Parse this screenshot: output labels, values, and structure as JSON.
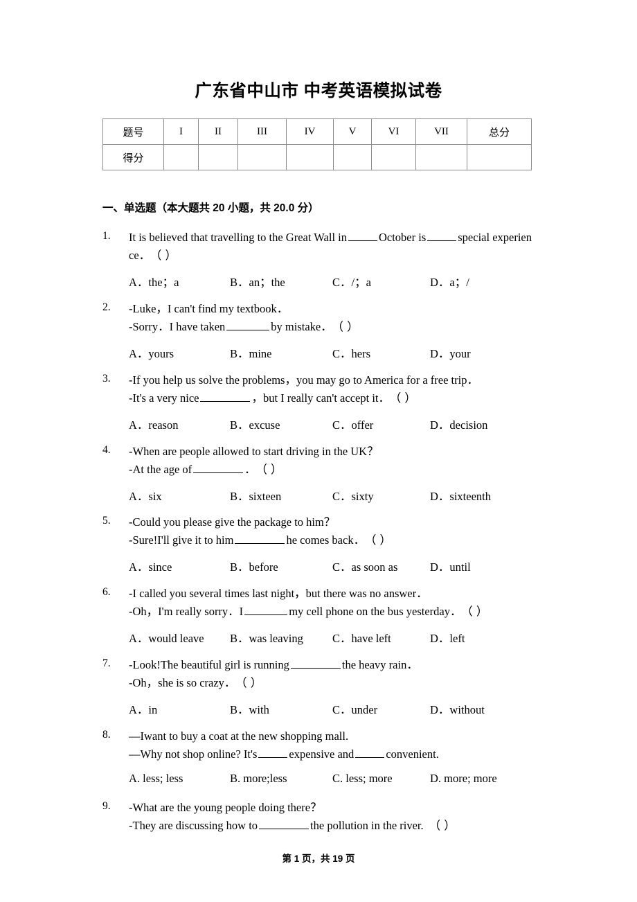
{
  "document": {
    "title": "广东省中山市 中考英语模拟试卷",
    "footer": "第 1 页，共 19 页"
  },
  "score_table": {
    "row_label_header": "题号",
    "row_label_score": "得分",
    "columns": [
      "I",
      "II",
      "III",
      "IV",
      "V",
      "VI",
      "VII"
    ],
    "total_label": "总分",
    "scores": [
      "",
      "",
      "",
      "",
      "",
      "",
      "",
      ""
    ]
  },
  "sections": [
    {
      "heading": "一、单选题（本大题共 20 小题，共 20.0 分）"
    }
  ],
  "questions": [
    {
      "number": "1.",
      "lines": [
        "It is believed that travelling to the Great Wall in ____ October is ____ special experience．（      ）"
      ],
      "line1_pre": "It is believed that travelling to the Great Wall in",
      "line1_mid": "October is",
      "line1_post": "special experien",
      "line2_pre": "ce．",
      "line2_paren": "（      ）",
      "options": [
        "A．the；a",
        "B．an；the",
        "C．/；a",
        "D．a；/"
      ]
    },
    {
      "number": "2.",
      "line1": "-Luke，I can't find my textbook．",
      "line2_pre": "-Sorry．I have taken",
      "line2_post": "by mistake．",
      "line2_paren": "（      ）",
      "options": [
        "A．yours",
        "B．mine",
        "C．hers",
        "D．your"
      ]
    },
    {
      "number": "3.",
      "line1": "-If you help us solve the problems，you may go to America for a free trip．",
      "line2_pre": "-It's a very nice",
      "line2_post": "，but I really can't accept it．",
      "line2_paren": "（      ）",
      "options": [
        "A．reason",
        "B．excuse",
        "C．offer",
        "D．decision"
      ]
    },
    {
      "number": "4.",
      "line1": "-When are people allowed to start driving in the UK？",
      "line2_pre": "-At the age of",
      "line2_post": "．",
      "line2_paren": "（      ）",
      "options": [
        "A．six",
        "B．sixteen",
        "C．sixty",
        "D．sixteenth"
      ]
    },
    {
      "number": "5.",
      "line1": "-Could you please give the package to him？",
      "line2_pre": "-Sure!I'll give it to him",
      "line2_post": "he comes back．",
      "line2_paren": "（      ）",
      "options": [
        "A．since",
        "B．before",
        "C．as soon as",
        "D．until"
      ]
    },
    {
      "number": "6.",
      "line1": "-I called you several times last night，but there was no answer．",
      "line2_pre": "-Oh，I'm really sorry．I",
      "line2_post": "my cell phone on the bus yesterday．",
      "line2_paren": "（      ）",
      "options": [
        "A．would leave",
        "B．was leaving",
        "C．have left",
        "D．left"
      ]
    },
    {
      "number": "7.",
      "line1_pre": "-Look!The beautiful girl is running",
      "line1_post": "the heavy rain．",
      "line2": "-Oh，she is so crazy．",
      "line2_paren": "（      ）",
      "options": [
        "A．in",
        "B．with",
        "C．under",
        "D．without"
      ]
    },
    {
      "number": "8.",
      "line1": "—Iwant to buy a coat at the new shopping mall.",
      "line2_pre": "—Why not shop online? It's",
      "line2_mid": "expensive and",
      "line2_post": "convenient.",
      "options": [
        "A. less; less",
        "B. more;less",
        "C. less; more",
        "D. more; more"
      ]
    },
    {
      "number": "9.",
      "line1": "-What are the young people doing there？",
      "line2_pre": "-They are discussing how to",
      "line2_post": "the pollution in the river.",
      "line2_paren": "（      ）"
    }
  ]
}
